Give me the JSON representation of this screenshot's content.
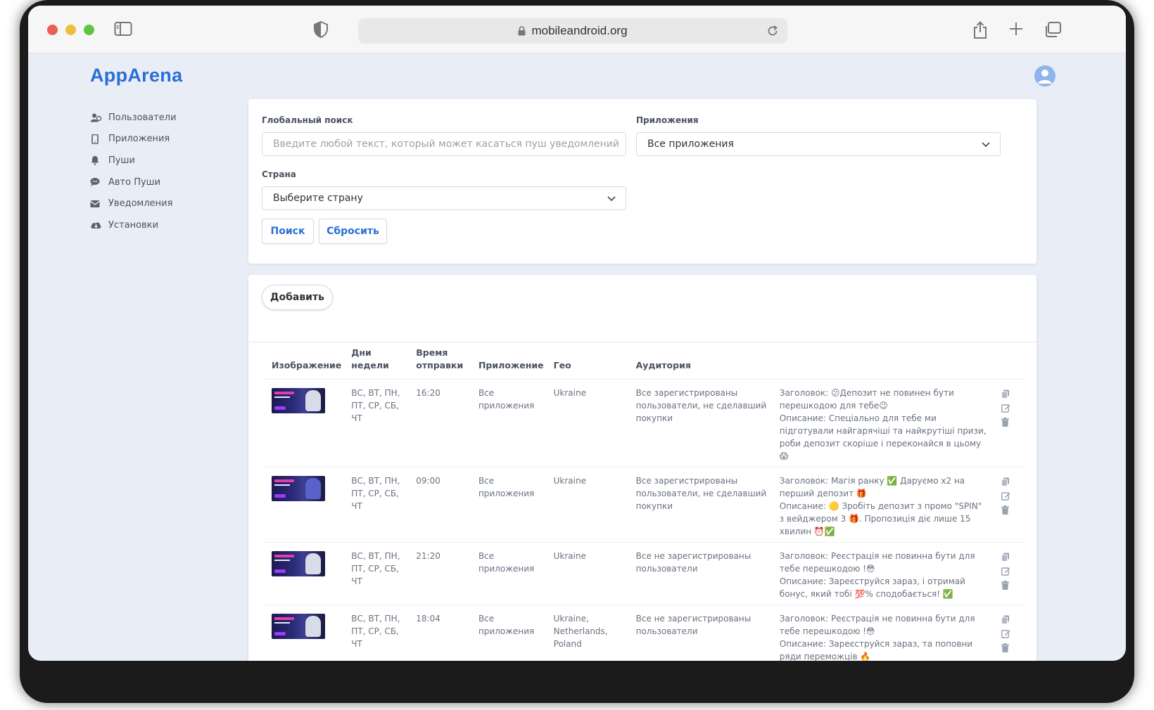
{
  "browser": {
    "url": "mobileandroid.org"
  },
  "app": {
    "logo": "AppArena"
  },
  "sidebar": {
    "items": [
      {
        "label": "Пользователи",
        "icon": "users-icon"
      },
      {
        "label": "Приложения",
        "icon": "mobile-icon"
      },
      {
        "label": "Пуши",
        "icon": "bell-icon"
      },
      {
        "label": "Авто Пуши",
        "icon": "comment-icon"
      },
      {
        "label": "Уведомления",
        "icon": "envelope-icon"
      },
      {
        "label": "Установки",
        "icon": "cloud-download-icon"
      }
    ]
  },
  "filters": {
    "search_label": "Глобальный поиск",
    "search_placeholder": "Введите любой текст, который может касаться пуш уведомлений",
    "apps_label": "Приложения",
    "apps_value": "Все приложения",
    "country_label": "Страна",
    "country_value": "Выберите страну",
    "search_button": "Поиск",
    "reset_button": "Сбросить"
  },
  "list": {
    "add_button": "Добавить",
    "columns": {
      "image": "Изображение",
      "days": "Дни недели",
      "time_line1": "Время",
      "time_line2": "отправки",
      "app": "Приложение",
      "geo": "Гео",
      "audience": "Аудитория"
    },
    "rows": [
      {
        "days": "ВС, ВТ, ПН, ПТ, СР, СБ, ЧТ",
        "time": "16:20",
        "app": "Все приложения",
        "geo": "Ukraine",
        "audience": "Все зарегистрированы пользователи, не сделавший покупки",
        "title": "Заголовок: 😕Депозит не повинен бути перешкодою для тебе😉",
        "desc": "Описание: Спеціально для тебе ми підготували найгарячіші та найкрутіші призи, роби депозит скоріше і переконайся в цьому 😱"
      },
      {
        "days": "ВС, ВТ, ПН, ПТ, СР, СБ, ЧТ",
        "time": "09:00",
        "app": "Все приложения",
        "geo": "Ukraine",
        "audience": "Все зарегистрированы пользователи, не сделавший покупки",
        "title": "Заголовок: Магія ранку ✅ Даруємо x2 на перший депозит 🎁",
        "desc": "Описание: 🟡 Зробіть депозит з промо \"SPIN\" з вейджером 3 🎁. Пропозиція діє лише 15 хвилин ⏰✅"
      },
      {
        "days": "ВС, ВТ, ПН, ПТ, СР, СБ, ЧТ",
        "time": "21:20",
        "app": "Все приложения",
        "geo": "Ukraine",
        "audience": "Все не зарегистрированы пользователи",
        "title": "Заголовок: Реєстрація не повинна бути для тебе перешкодою !😳",
        "desc": "Описание: Зареєструйся зараз, і отримай бонус, який тобі 💯% сподобається! ✅"
      },
      {
        "days": "ВС, ВТ, ПН, ПТ, СР, СБ, ЧТ",
        "time": "18:04",
        "app": "Все приложения",
        "geo": "Ukraine, Netherlands, Poland",
        "audience": "Все не зарегистрированы пользователи",
        "title": "Заголовок: Реєстрація не повинна бути для тебе перешкодою !😳",
        "desc": "Описание: Зареєструйся зараз, та поповни ряди переможців 🔥"
      }
    ]
  },
  "colors": {
    "accent": "#2b6fd6",
    "page_bg": "#e9eef6"
  }
}
